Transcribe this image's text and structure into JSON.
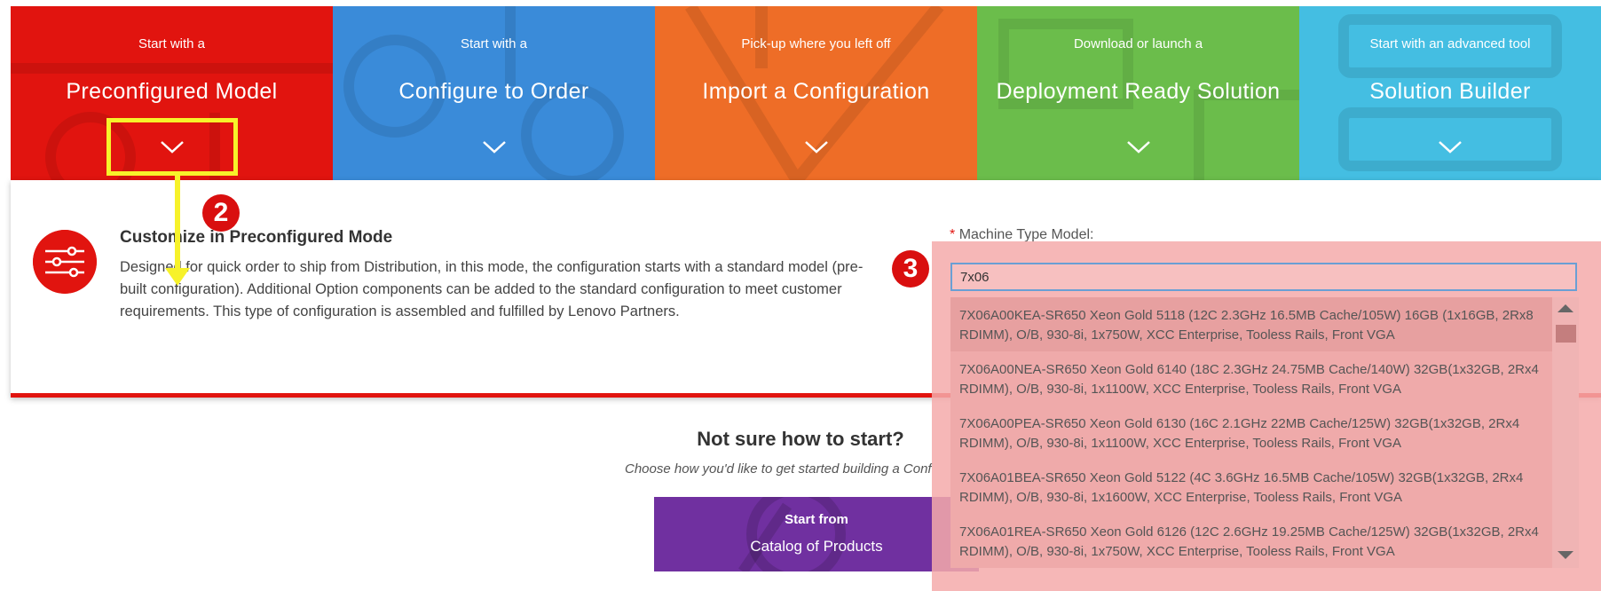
{
  "tiles": [
    {
      "kicker": "Start with a",
      "title": "Preconfigured Model",
      "color": "#e1140f"
    },
    {
      "kicker": "Start with a",
      "title": "Configure to Order",
      "color": "#3a8bd9"
    },
    {
      "kicker": "Pick-up where you left off",
      "title": "Import a Configuration",
      "color": "#ee6d27"
    },
    {
      "kicker": "Download or launch a",
      "title": "Deployment Ready Solution",
      "color": "#6bbd4b"
    },
    {
      "kicker": "Start with an advanced tool",
      "title": "Solution Builder",
      "color": "#44bee2"
    }
  ],
  "panel": {
    "title": "Customize in Preconfigured Mode",
    "description": "Designed for quick order to ship from Distribution, in this mode, the configuration starts with a standard model (pre-built configuration). Additional Option components can be added to the standard configuration to meet customer requirements. This type of configuration is assembled and fulfilled by Lenovo Partners.",
    "icon": "sliders-icon"
  },
  "machine_type_model": {
    "required_mark": "*",
    "label": "Machine Type Model:",
    "value": "7x06",
    "options": [
      "7X06A00KEA-SR650 Xeon Gold 5118 (12C 2.3GHz 16.5MB Cache/105W) 16GB (1x16GB, 2Rx8 RDIMM), O/B, 930-8i, 1x750W, XCC Enterprise, Tooless Rails, Front VGA",
      "7X06A00NEA-SR650 Xeon Gold 6140 (18C 2.3GHz 24.75MB Cache/140W) 32GB(1x32GB, 2Rx4 RDIMM), O/B, 930-8i, 1x1100W, XCC Enterprise, Tooless Rails, Front VGA",
      "7X06A00PEA-SR650 Xeon Gold 6130 (16C 2.1GHz 22MB Cache/125W) 32GB(1x32GB, 2Rx4 RDIMM), O/B, 930-8i, 1x1100W, XCC Enterprise, Tooless Rails, Front VGA",
      "7X06A01BEA-SR650 Xeon Gold 5122 (4C 3.6GHz 16.5MB Cache/105W) 32GB(1x32GB, 2Rx4 RDIMM), O/B, 930-8i, 1x1600W, XCC Enterprise, Tooless Rails, Front VGA",
      "7X06A01REA-SR650 Xeon Gold 6126 (12C 2.6GHz 19.25MB Cache/125W) 32GB(1x32GB, 2Rx4 RDIMM), O/B, 930-8i, 1x750W, XCC Enterprise, Tooless Rails, Front VGA"
    ]
  },
  "help": {
    "heading": "Not sure how to start?",
    "subtext": "Choose how you'd like to get started building a Conf",
    "catalog_button": {
      "line1": "Start from",
      "line2": "Catalog of Products",
      "color": "#7030a0"
    }
  },
  "annotations": {
    "step2": "2",
    "step3": "3",
    "highlight_color": "#f7f22a",
    "badge_color": "#d90f0f"
  }
}
